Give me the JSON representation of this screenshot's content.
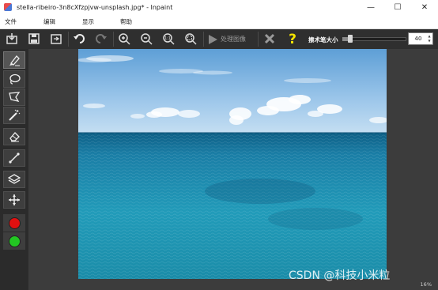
{
  "window": {
    "title": "stella-ribeiro-3n8cXfzpjvw-unsplash.jpg* - Inpaint",
    "minimize": "—",
    "maximize": "☐",
    "close": "✕"
  },
  "menu": {
    "file": "文件",
    "edit": "编辑",
    "view": "显示",
    "help": "帮助"
  },
  "toolbar": {
    "process_label": "处理图像",
    "brush_size_label": "擦术笔大小",
    "brush_size_value": "40",
    "brush_size_fraction": 0.1
  },
  "palette": {
    "primary": "#e01010",
    "secondary": "#22c622"
  },
  "status": {
    "zoom": "16%"
  },
  "watermark": "CSDN @科技小米粒"
}
